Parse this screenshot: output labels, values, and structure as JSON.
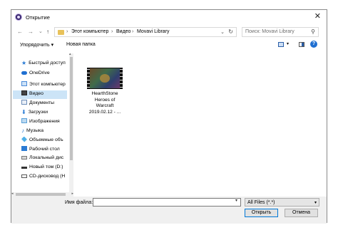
{
  "window": {
    "title": "Открытие",
    "close_glyph": "✕"
  },
  "nav": {
    "back": "←",
    "forward": "→",
    "dropdown": "⌄",
    "up": "↑"
  },
  "address": {
    "crumbs": [
      "Этот компьютер",
      "Видео",
      "Movavi Library"
    ],
    "separator": "›",
    "dropdown": "⌄",
    "refresh": "↻"
  },
  "search": {
    "placeholder": "Поиск: Movavi Library",
    "icon": "search-icon"
  },
  "toolbar": {
    "organize_label": "Упорядочить ▾",
    "new_folder_label": "Новая папка",
    "view_caret": "▾",
    "help": "?"
  },
  "sidebar": {
    "items": [
      {
        "label": "Быстрый доступ",
        "icon": "star-icon",
        "color": "#2a7bd4"
      },
      {
        "label": "OneDrive",
        "icon": "cloud-icon",
        "color": "#1f6fd1"
      },
      {
        "label": "Этот компьютер",
        "icon": "computer-icon",
        "color": "#4a8ad8"
      },
      {
        "label": "Видео",
        "icon": "video-folder-icon",
        "color": "#444444",
        "selected": true
      },
      {
        "label": "Документы",
        "icon": "documents-icon",
        "color": "#6b8cb8"
      },
      {
        "label": "Загрузки",
        "icon": "downloads-icon",
        "color": "#2a7bd4"
      },
      {
        "label": "Изображения",
        "icon": "pictures-icon",
        "color": "#5aa0d8"
      },
      {
        "label": "Музыка",
        "icon": "music-icon",
        "color": "#2a7bd4"
      },
      {
        "label": "Объемные объ",
        "icon": "3d-objects-icon",
        "color": "#4fb0e8"
      },
      {
        "label": "Рабочий стол",
        "icon": "desktop-icon",
        "color": "#2a7bd4"
      },
      {
        "label": "Локальный дис",
        "icon": "drive-icon",
        "color": "#777777"
      },
      {
        "label": "Новый том (D:)",
        "icon": "drive-icon",
        "color": "#777777"
      },
      {
        "label": "CD-дисковод (H",
        "icon": "cd-drive-icon",
        "color": "#555555"
      }
    ],
    "scroll_up": "▴",
    "scroll_down": "▾",
    "scroll_left": "◂",
    "scroll_right": "▸"
  },
  "files": [
    {
      "name_lines": [
        "HearthStone",
        "Heroes of",
        "Warcraft",
        "2019.02.12 - ..."
      ]
    }
  ],
  "bottom": {
    "filename_label": "Имя файла:",
    "filename_value": "",
    "filename_dropdown": "▾",
    "filetype_value": "All Files (*.*)",
    "filetype_caret": "▾",
    "open_label": "Открыть",
    "cancel_label": "Отмена"
  }
}
